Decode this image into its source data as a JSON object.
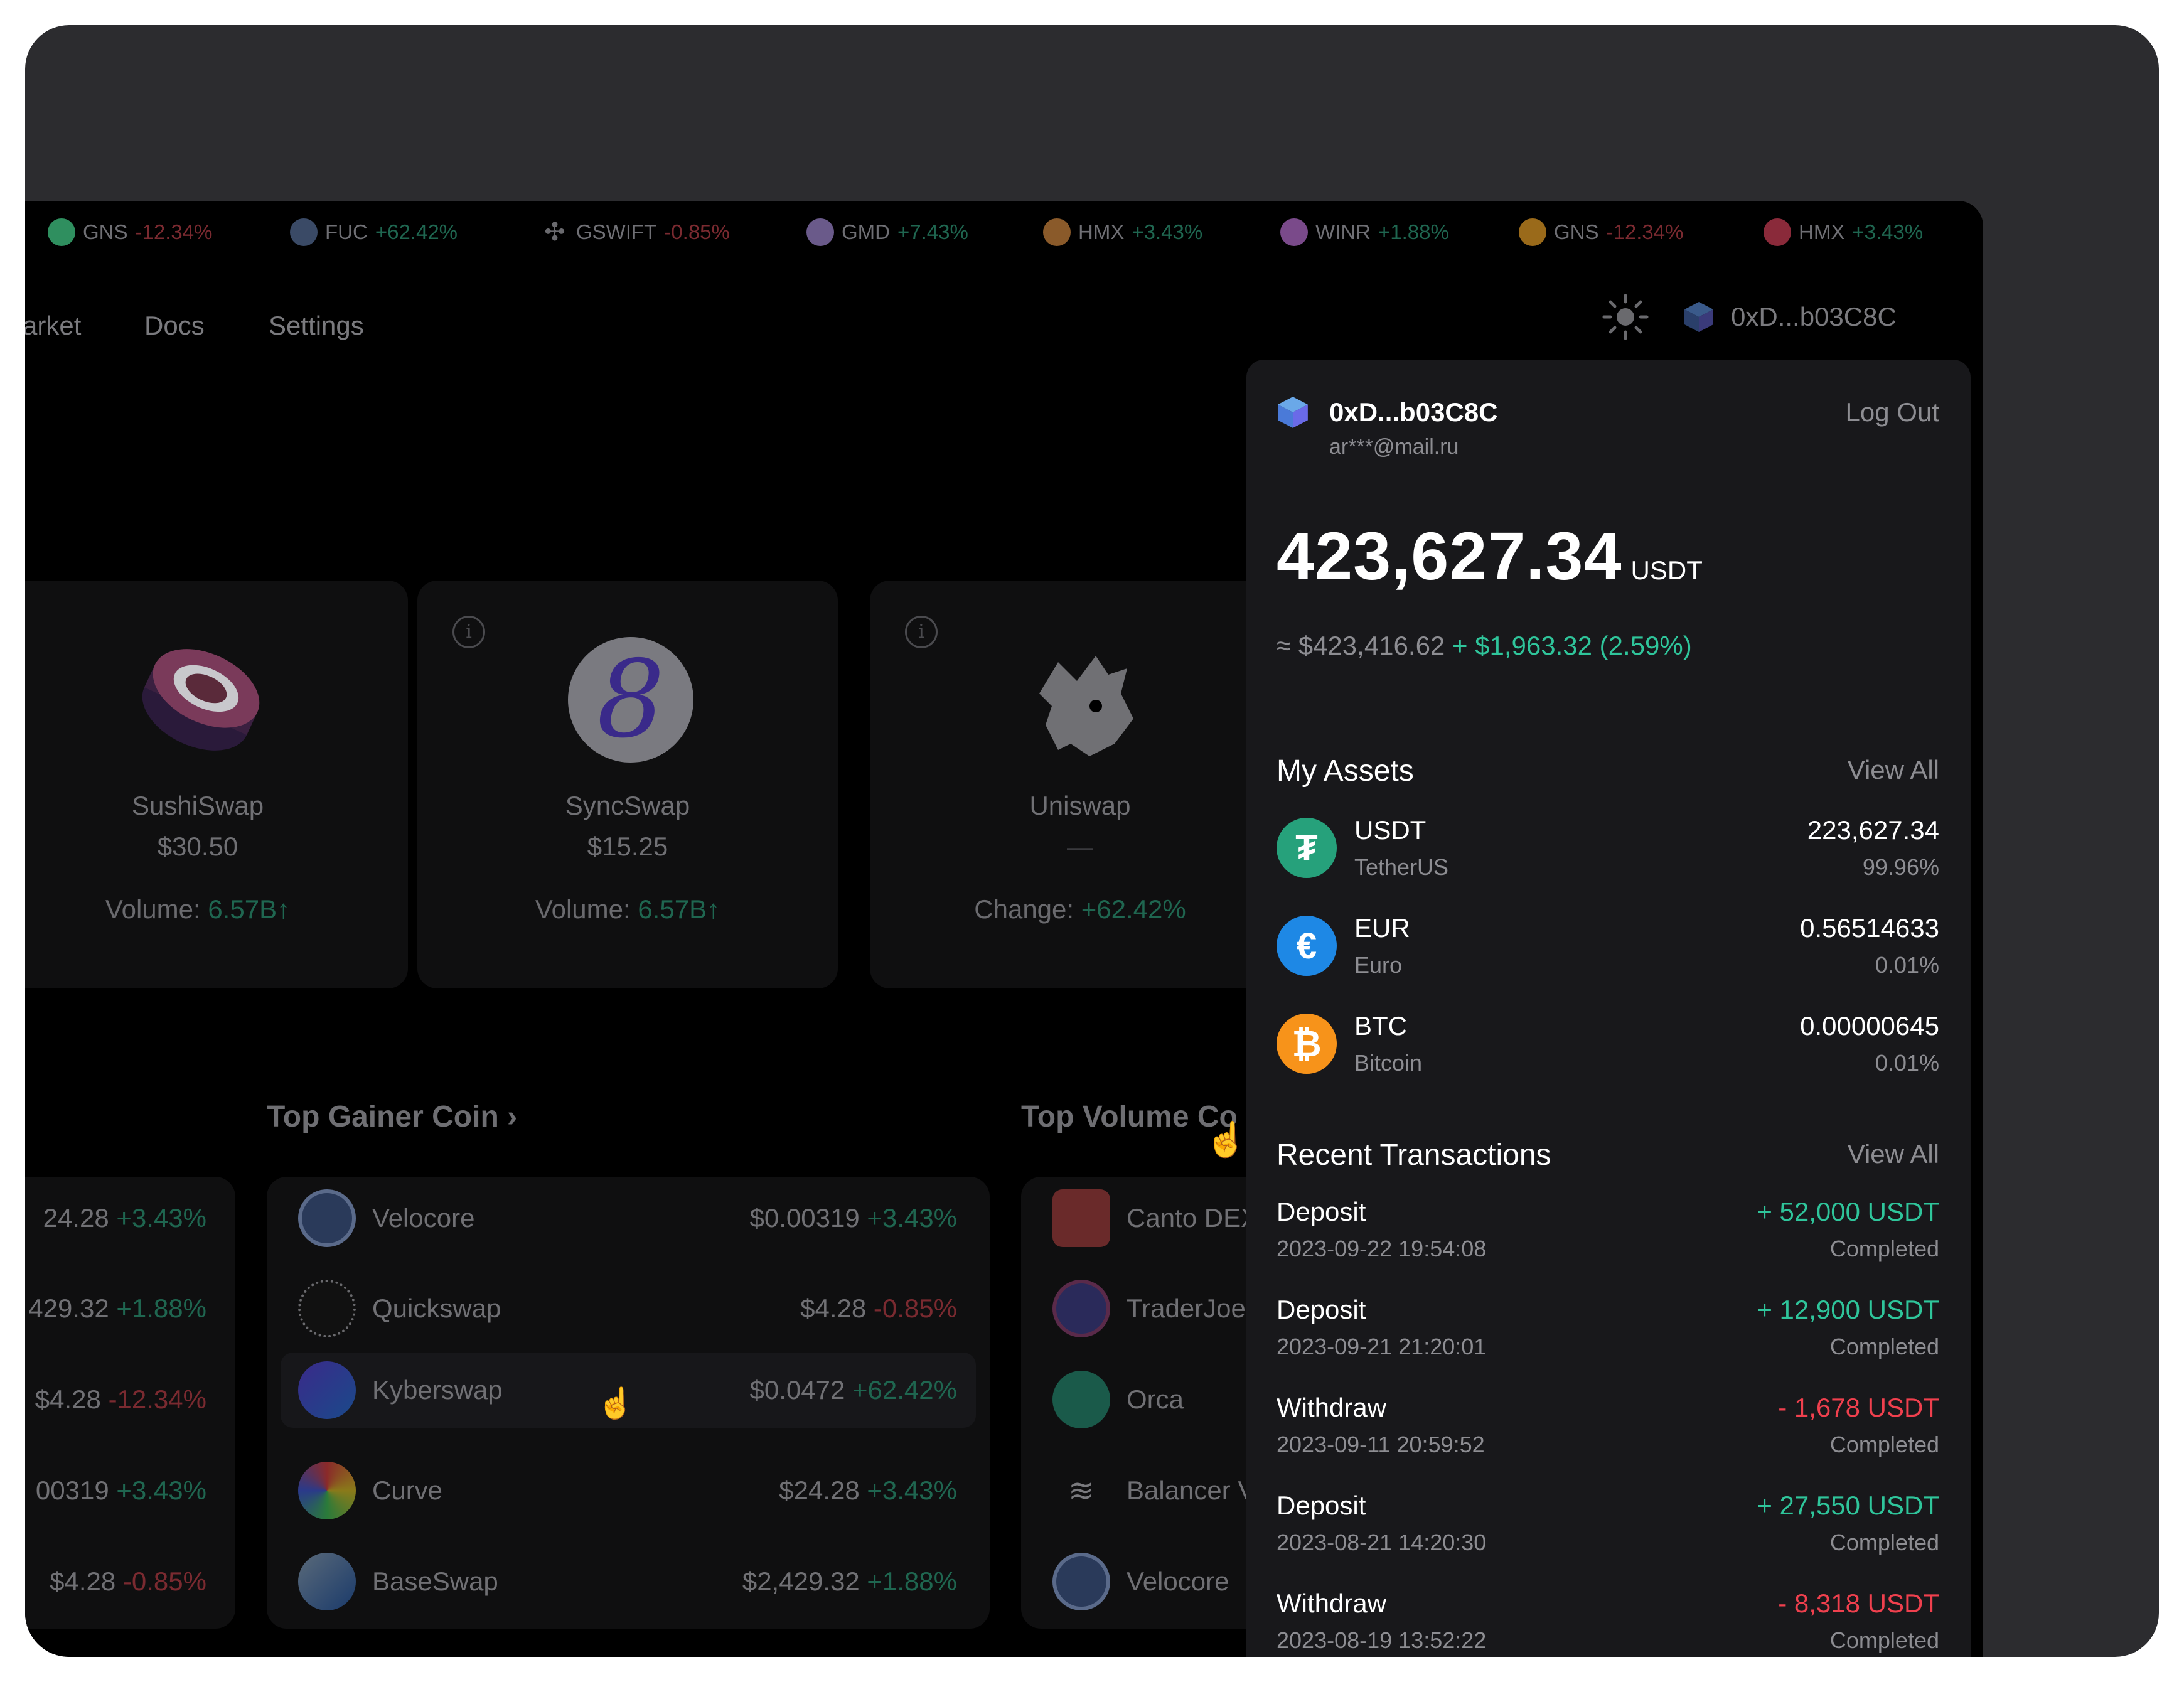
{
  "ticker": [
    {
      "symbol": "GNS",
      "change": "-12.34%",
      "dir": "neg",
      "color": "#2f8f5f"
    },
    {
      "symbol": "FUC",
      "change": "+62.42%",
      "dir": "pos",
      "color": "#3a4a66"
    },
    {
      "symbol": "GSWIFT",
      "change": "-0.85%",
      "dir": "neg",
      "color": "#6a6a6e"
    },
    {
      "symbol": "GMD",
      "change": "+7.43%",
      "dir": "pos",
      "color": "#6a5a8a"
    },
    {
      "symbol": "HMX",
      "change": "+3.43%",
      "dir": "pos",
      "color": "#8a5a2a"
    },
    {
      "symbol": "WINR",
      "change": "+1.88%",
      "dir": "pos",
      "color": "#7a4a8a"
    },
    {
      "symbol": "GNS",
      "change": "-12.34%",
      "dir": "neg",
      "color": "#9a6a1a"
    },
    {
      "symbol": "HMX",
      "change": "+3.43%",
      "dir": "pos",
      "color": "#8a2a3a"
    }
  ],
  "nav": {
    "market": "arket",
    "docs": "Docs",
    "settings": "Settings",
    "wallet": "0xD...b03C8C"
  },
  "cards": [
    {
      "name": "SushiSwap",
      "price": "$30.50",
      "metric_label": "Volume:",
      "metric_value": "6.57B",
      "arrow": "↑"
    },
    {
      "name": "SyncSwap",
      "price": "$15.25",
      "metric_label": "Volume:",
      "metric_value": "6.57B",
      "arrow": "↑"
    },
    {
      "name": "Uniswap",
      "price": "—",
      "metric_label": "Change:",
      "metric_value": "+62.42%",
      "arrow": ""
    }
  ],
  "sections": {
    "top_gainer": "Top Gainer Coin",
    "top_volume": "Top Volume Co"
  },
  "left_list": [
    {
      "value": "24.28",
      "change": "+3.43%",
      "dir": "pos"
    },
    {
      "value": "429.32",
      "change": "+1.88%",
      "dir": "pos"
    },
    {
      "value": "$4.28",
      "change": "-12.34%",
      "dir": "neg"
    },
    {
      "value": "00319",
      "change": "+3.43%",
      "dir": "pos"
    },
    {
      "value": "$4.28",
      "change": "-0.85%",
      "dir": "neg"
    }
  ],
  "gainers": [
    {
      "name": "Velocore",
      "price": "$0.00319",
      "change": "+3.43%",
      "dir": "pos"
    },
    {
      "name": "Quickswap",
      "price": "$4.28",
      "change": "-0.85%",
      "dir": "neg"
    },
    {
      "name": "Kyberswap",
      "price": "$0.0472",
      "change": "+62.42%",
      "dir": "pos"
    },
    {
      "name": "Curve",
      "price": "$24.28",
      "change": "+3.43%",
      "dir": "pos"
    },
    {
      "name": "BaseSwap",
      "price": "$2,429.32",
      "change": "+1.88%",
      "dir": "pos"
    }
  ],
  "volume": [
    {
      "name": "Canto DEX"
    },
    {
      "name": "TraderJoe"
    },
    {
      "name": "Orca"
    },
    {
      "name": "Balancer V"
    },
    {
      "name": "Velocore"
    }
  ],
  "panel": {
    "address": "0xD...b03C8C",
    "email": "ar***@mail.ru",
    "logout": "Log Out",
    "balance": "423,627.34",
    "balance_unit": "USDT",
    "approx": "≈ $423,416.62",
    "gain": "+ $1,963.32 (2.59%)",
    "assets_title": "My Assets",
    "view_all": "View All",
    "assets": [
      {
        "symbol": "USDT",
        "name": "TetherUS",
        "amount": "223,627.34",
        "share": "99.96%",
        "color": "#26a17b",
        "glyph": "₮"
      },
      {
        "symbol": "EUR",
        "name": "Euro",
        "amount": "0.56514633",
        "share": "0.01%",
        "color": "#1e88e5",
        "glyph": "€"
      },
      {
        "symbol": "BTC",
        "name": "Bitcoin",
        "amount": "0.00000645",
        "share": "0.01%",
        "color": "#f7931a",
        "glyph": "₿"
      }
    ],
    "tx_title": "Recent Transactions",
    "transactions": [
      {
        "type": "Deposit",
        "date": "2023-09-22 19:54:08",
        "amount": "+ 52,000 USDT",
        "status": "Completed",
        "dir": "pos"
      },
      {
        "type": "Deposit",
        "date": "2023-09-21 21:20:01",
        "amount": "+ 12,900 USDT",
        "status": "Completed",
        "dir": "pos"
      },
      {
        "type": "Withdraw",
        "date": "2023-09-11 20:59:52",
        "amount": "- 1,678 USDT",
        "status": "Completed",
        "dir": "neg"
      },
      {
        "type": "Deposit",
        "date": "2023-08-21 14:20:30",
        "amount": "+ 27,550 USDT",
        "status": "Completed",
        "dir": "pos"
      },
      {
        "type": "Withdraw",
        "date": "2023-08-19 13:52:22",
        "amount": "- 8,318 USDT",
        "status": "Completed",
        "dir": "neg"
      }
    ]
  }
}
